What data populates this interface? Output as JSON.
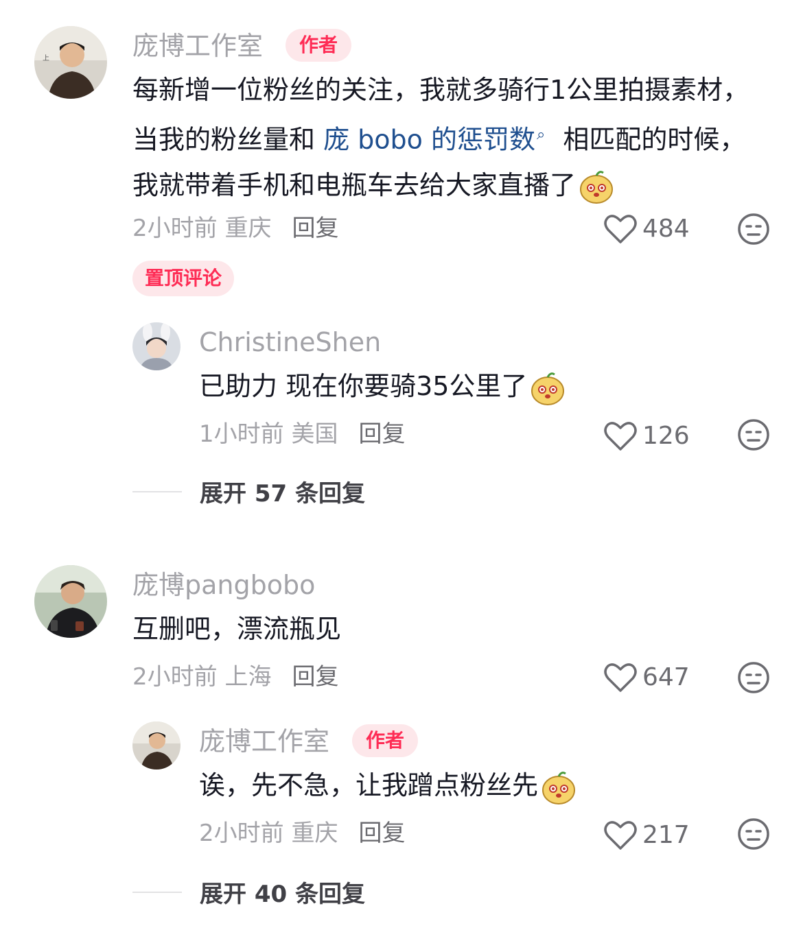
{
  "comments": [
    {
      "username": "庞博工作室",
      "badge": "作者",
      "text_before": "每新增一位粉丝的关注，我就多骑行1公里拍摄素材，当我的粉丝量和 ",
      "mention": "庞 bobo 的惩罚数",
      "text_after": " 相匹配的时候，我就带着手机和电瓶车去给大家直播了",
      "time_location": "2小时前 重庆",
      "reply_label": "回复",
      "likes": "484",
      "pinned_label": "置顶评论",
      "reply": {
        "username": "ChristineShen",
        "text": "已助力 现在你要骑35公里了",
        "time_location": "1小时前 美国",
        "reply_label": "回复",
        "likes": "126"
      },
      "expand_label": "展开 57 条回复"
    },
    {
      "username": "庞博pangbobo",
      "text": "互删吧，漂流瓶见",
      "time_location": "2小时前 上海",
      "reply_label": "回复",
      "likes": "647",
      "reply": {
        "username": "庞博工作室",
        "badge": "作者",
        "text": "诶，先不急，让我蹭点粉丝先",
        "time_location": "2小时前 重庆",
        "reply_label": "回复",
        "likes": "217"
      },
      "expand_label": "展开 40 条回复"
    }
  ],
  "icons": {
    "like": "heart-outline-icon",
    "dislike": "meh-face-icon",
    "emoji": "cute-face-emoji",
    "search": "search-icon"
  },
  "colors": {
    "accent": "#fe2c55",
    "badge_bg": "#fde7ea",
    "mention": "#1f4f8f",
    "muted": "#a3a3a8"
  }
}
